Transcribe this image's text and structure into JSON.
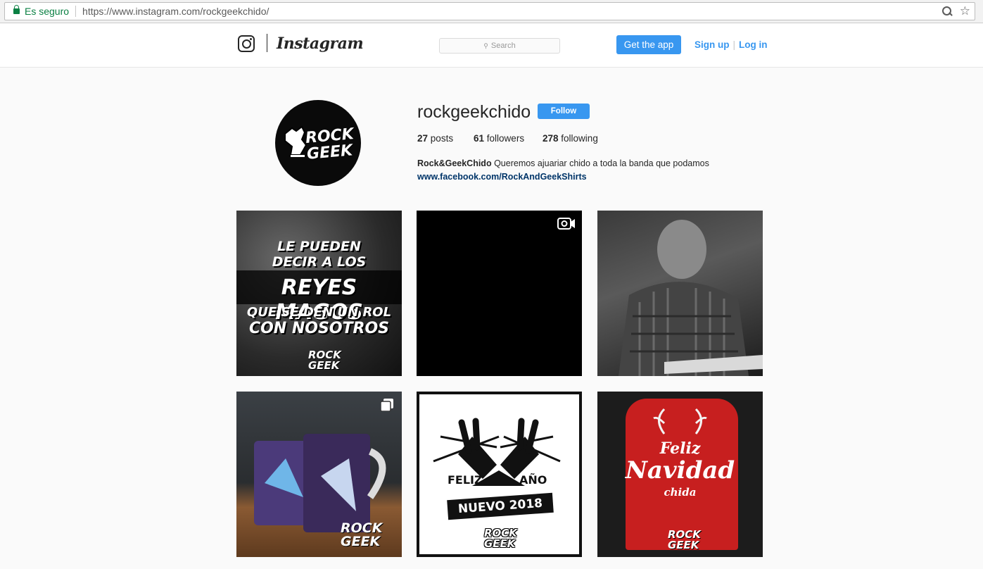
{
  "browser": {
    "security_label": "Es seguro",
    "url_host": "https://www.instagram.com",
    "url_path": "/rockgeekchido/"
  },
  "header": {
    "wordmark": "Instagram",
    "search_placeholder": "Search",
    "get_app_label": "Get the app",
    "signup_label": "Sign up",
    "separator": "|",
    "login_label": "Log in"
  },
  "profile": {
    "username": "rockgeekchido",
    "follow_label": "Follow",
    "posts_count": "27",
    "posts_label": "posts",
    "followers_count": "61",
    "followers_label": "followers",
    "following_count": "278",
    "following_label": "following",
    "full_name": "Rock&GeekChido",
    "bio": "Queremos ajuariar chido a toda la banda que podamos",
    "website": "www.facebook.com/RockAndGeekShirts"
  },
  "posts": [
    {
      "type": "image",
      "lines": [
        "LE PUEDEN",
        "DECIR A LOS",
        "REYES MAGOS",
        "QUE SE DEN UN ROL",
        "CON NOSOTROS"
      ],
      "brand": [
        "ROCK",
        "GEEK"
      ]
    },
    {
      "type": "video",
      "icon": "video-icon"
    },
    {
      "type": "image",
      "icon": "none"
    },
    {
      "type": "carousel",
      "icon": "multiple-images-icon",
      "brand": [
        "ROCK",
        "GEEK"
      ]
    },
    {
      "type": "image",
      "lines": [
        "FELIZ",
        "AÑO",
        "NUEVO 2018"
      ],
      "brand": [
        "ROCK",
        "GEEK"
      ]
    },
    {
      "type": "image",
      "lines": [
        "Feliz",
        "Navidad",
        "chida"
      ],
      "brand": [
        "ROCK",
        "GEEK"
      ]
    }
  ],
  "colors": {
    "accent": "#3897f0",
    "link": "#003569",
    "secure_green": "#0b8043"
  }
}
